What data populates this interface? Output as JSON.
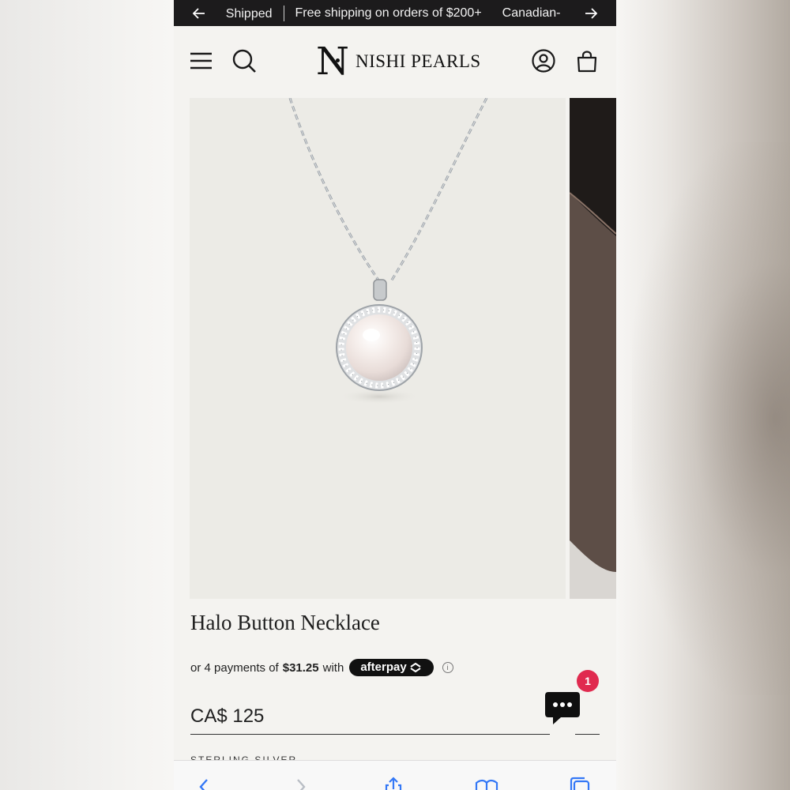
{
  "announcement": {
    "messages": [
      "․ Shipped",
      "Free shipping on orders of $200+",
      "Canadian-"
    ]
  },
  "header": {
    "logo_mark": "N",
    "logo_word": "NISHI PEARLS"
  },
  "product": {
    "title": "Halo Button Necklace",
    "installments_prefix": "or 4 payments of",
    "installment_amount": "$31.25",
    "installments_with": "with",
    "afterpay_label": "afterpay",
    "price": "CA$ 125",
    "next_label": "STERLING SILVER"
  },
  "chat": {
    "badge_count": "1"
  }
}
